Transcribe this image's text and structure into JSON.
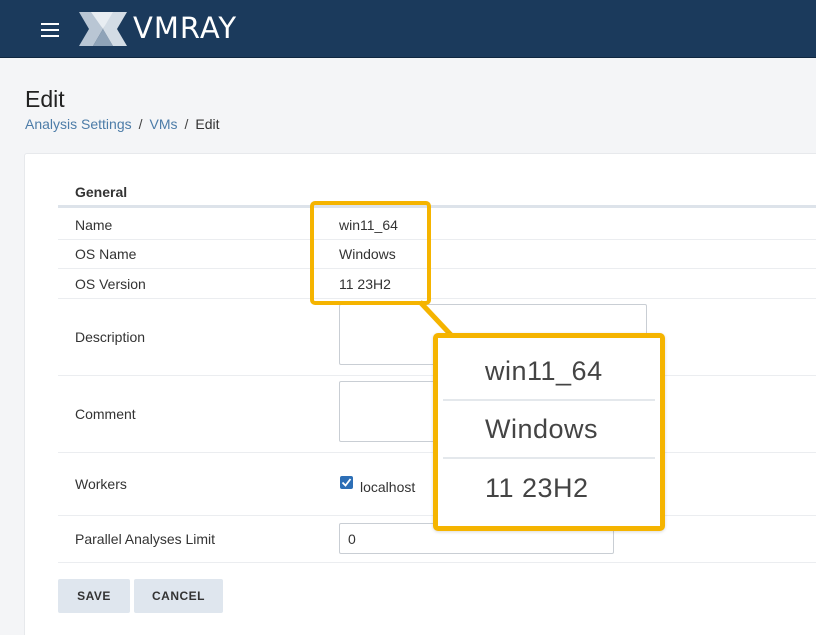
{
  "header": {
    "brand": "VMRAY",
    "menu_icon": "hamburger-menu-icon",
    "logo_icon": "vmray-logo-mark",
    "background_color": "#1b3a5c"
  },
  "page": {
    "title": "Edit",
    "breadcrumb": [
      "Analysis Settings",
      "VMs",
      "Edit"
    ]
  },
  "form": {
    "section_title": "General",
    "rows": {
      "name": {
        "label": "Name",
        "value": "win11_64"
      },
      "os_name": {
        "label": "OS Name",
        "value": "Windows"
      },
      "os_version": {
        "label": "OS Version",
        "value": "11 23H2"
      },
      "description": {
        "label": "Description",
        "value": ""
      },
      "comment": {
        "label": "Comment",
        "value": ""
      },
      "workers": {
        "label": "Workers",
        "option": "localhost",
        "checked": true
      },
      "parallel_limit": {
        "label": "Parallel Analyses Limit",
        "value": "0"
      }
    }
  },
  "actions": {
    "save_label": "SAVE",
    "cancel_label": "CANCEL"
  },
  "zoom_callout": {
    "lines": [
      "win11_64",
      "Windows",
      "11 23H2"
    ],
    "accent_color": "#f5b400"
  }
}
